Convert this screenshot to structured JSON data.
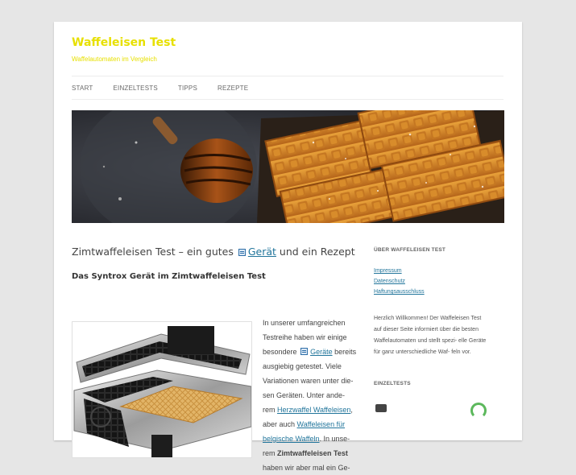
{
  "header": {
    "site_title": "Waffeleisen Test",
    "site_description": "Waffelautomaten im Vergleich"
  },
  "nav": {
    "items": [
      {
        "label": "START"
      },
      {
        "label": "EINZELTESTS"
      },
      {
        "label": "TIPPS"
      },
      {
        "label": "REZEPTE"
      }
    ]
  },
  "post": {
    "title_before": "Zimtwaffeleisen Test – ein gutes",
    "title_link": "Gerät",
    "title_after": "und ein Rezept",
    "subheading": "Das Syntrox Gerät im Zimtwaffeleisen Test",
    "p1": "In unserer umfangreichen Testreihe haben wir einige besondere",
    "p1_link": "Geräte",
    "p2": "bereits ausgiebig getestet. Viele Variationen waren unter die- sen Geräten. Unter ande- rem",
    "link_herz": "Herzwaffel Waffeleisen",
    "p3": ", aber auch",
    "link_belg": "Waffeleisen für belgische Waffeln",
    "p4": ". In unse- rem",
    "bold": "Zimtwaffeleisen Test",
    "p5": "haben wir aber mal ein Ge-"
  },
  "sidebar": {
    "about_title": "ÜBER WAFFELEISEN TEST",
    "links": [
      "Impressum",
      "Datenschutz",
      "Haftungsausschluss"
    ],
    "welcome_text": "Herzlich Willkommen! Der Waffeleisen Test auf dieser Seite informiert über die besten Waffelautomaten und stellt spezi- elle Geräte für ganz unterschiedliche Waf- feln vor.",
    "tests_title": "EINZELTESTS"
  },
  "colors": {
    "title_yellow": "#e7e000",
    "link_blue": "#21759b",
    "page_bg": "#e6e6e6"
  }
}
